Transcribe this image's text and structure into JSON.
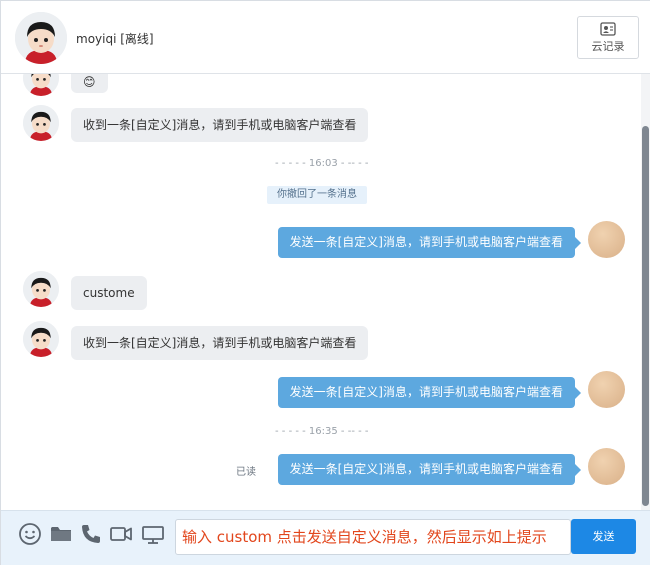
{
  "header": {
    "contact_name": "moyiqi [离线]",
    "cloud_record_label": "云记录"
  },
  "messages": {
    "top_partial_emoji": "😊",
    "m1": "收到一条[自定义]消息，请到手机或电脑客户端查看",
    "time_1603": "- - - - - 16:03 - -- - -",
    "recall": "你撤回了一条消息",
    "m2": "发送一条[自定义]消息，请到手机或电脑客户端查看",
    "m3": "custome",
    "m4": "收到一条[自定义]消息，请到手机或电脑客户端查看",
    "m5": "发送一条[自定义]消息，请到手机或电脑客户端查看",
    "time_1635": "- - - - - 16:35 - -- - -",
    "read_label": "已读",
    "m6": "发送一条[自定义]消息，请到手机或电脑客户端查看"
  },
  "input": {
    "value": "输入 custom 点击发送自定义消息，然后显示如上提示",
    "send_label": "发送"
  },
  "toolbar": {
    "icons": [
      "emoji-icon",
      "folder-icon",
      "phone-icon",
      "video-icon",
      "screen-icon"
    ]
  },
  "colors": {
    "outgoing_bubble": "#5da8df",
    "incoming_bubble": "#eceef1",
    "send_button": "#1d88e5",
    "input_text": "#e2461c",
    "input_bar_bg": "#e8f2fb"
  }
}
